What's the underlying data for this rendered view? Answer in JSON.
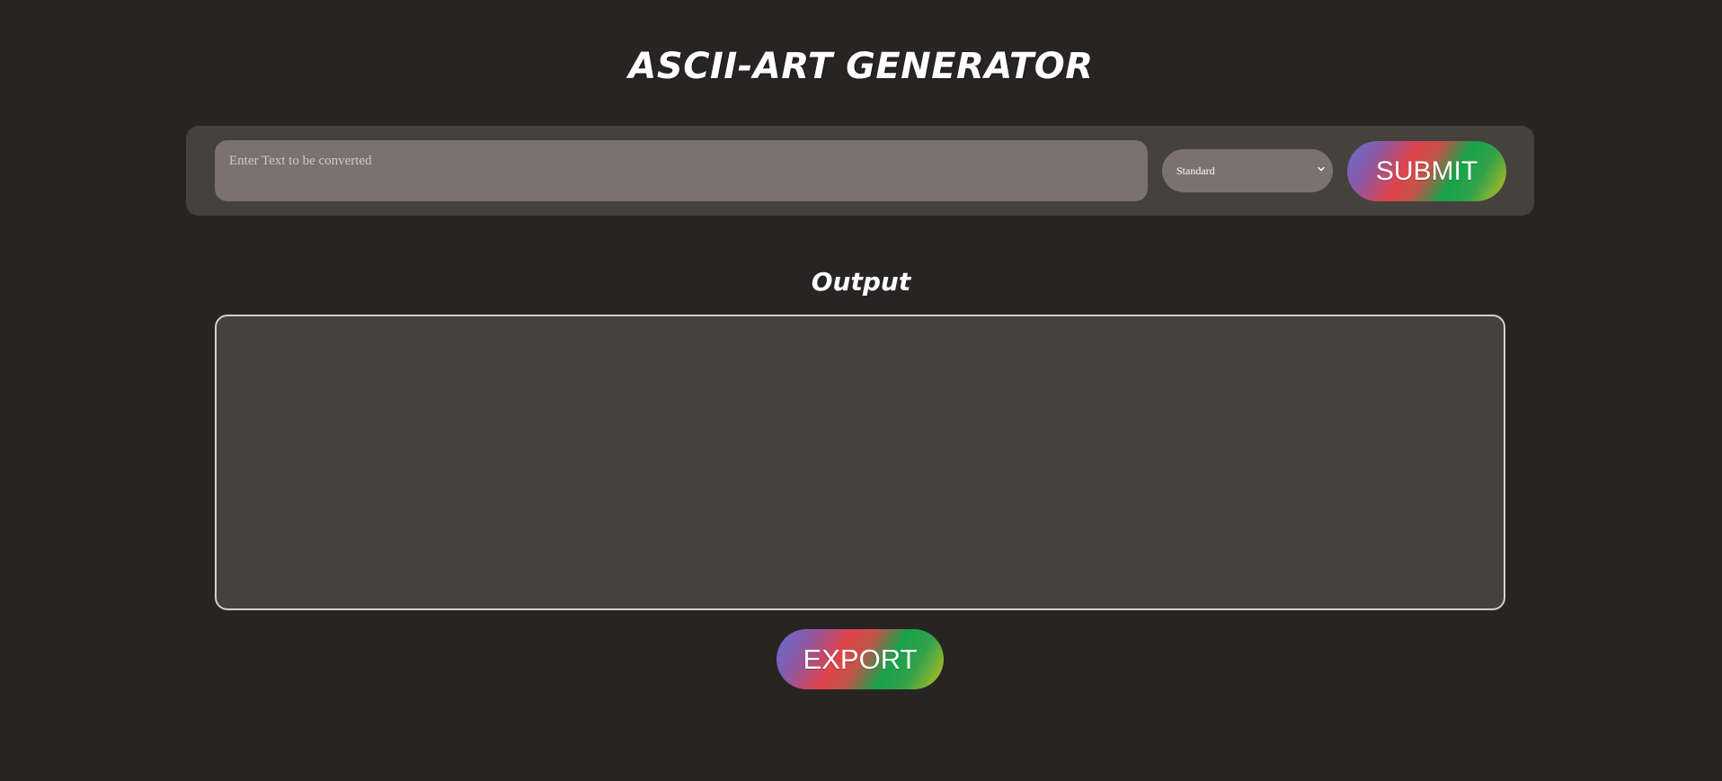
{
  "header": {
    "title": "ASCII-ART GENERATOR"
  },
  "input": {
    "placeholder": "Enter Text to be converted",
    "value": ""
  },
  "font_select": {
    "selected": "Standard"
  },
  "buttons": {
    "submit_label": "SUBMIT",
    "export_label": "EXPORT"
  },
  "output": {
    "heading": "Output",
    "content": ""
  },
  "colors": {
    "background": "#282424",
    "panel": "#45413d",
    "field": "#7b726e",
    "gradient": [
      "#5f6fcf",
      "#e0434b",
      "#16a34a",
      "#c5c21a"
    ]
  }
}
